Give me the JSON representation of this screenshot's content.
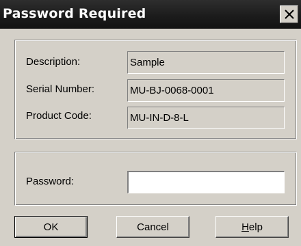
{
  "window": {
    "title": "Password Required"
  },
  "info": {
    "description_label": "Description:",
    "description_value": "Sample",
    "serial_label": "Serial Number:",
    "serial_value": "MU-BJ-0068-0001",
    "product_label": "Product Code:",
    "product_value": "MU-IN-D-8-L"
  },
  "password": {
    "label": "Password:",
    "value": ""
  },
  "buttons": {
    "ok": "OK",
    "cancel": "Cancel",
    "help_mnemonic": "H",
    "help_rest": "elp"
  },
  "icons": {
    "close": "close-icon"
  }
}
